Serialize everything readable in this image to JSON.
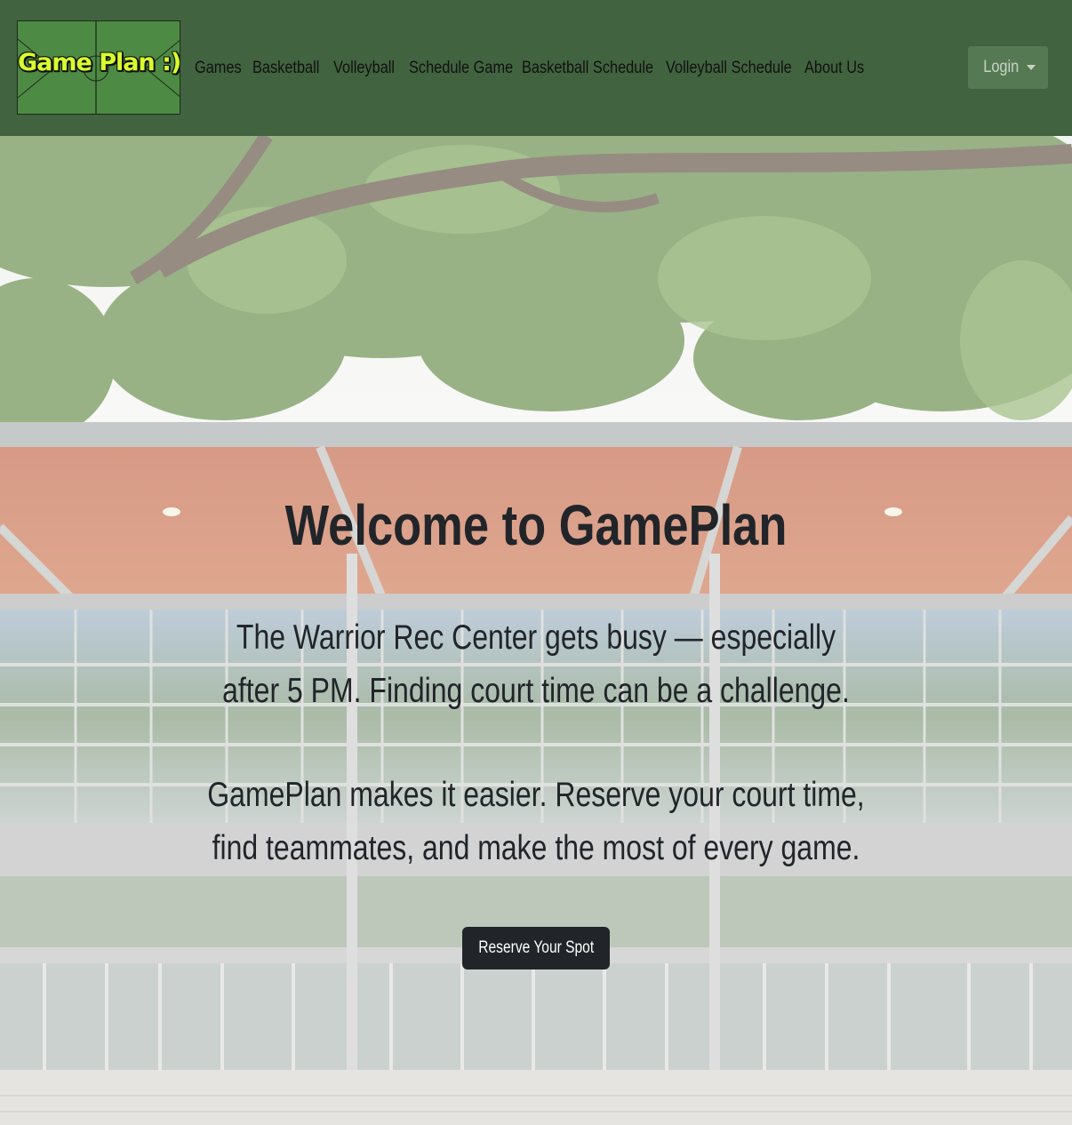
{
  "brand": {
    "logo_text": "Game Plan :)"
  },
  "nav": {
    "items": [
      {
        "label": "Games"
      },
      {
        "label": "Basketball"
      },
      {
        "label": "Volleyball"
      },
      {
        "label": "Schedule Game"
      },
      {
        "label": "Basketball Schedule"
      },
      {
        "label": "Volleyball Schedule"
      },
      {
        "label": "About Us"
      }
    ],
    "login_label": "Login"
  },
  "hero": {
    "title": "Welcome to GamePlan",
    "paragraph_1": "The Warrior Rec Center gets busy — especially after 5 PM. Finding court time can be a challenge.",
    "paragraph_2": "GamePlan makes it easier. Reserve your court time, find teammates, and make the most of every game.",
    "cta_label": "Reserve Your Spot"
  },
  "colors": {
    "navbar_bg": "#41633f",
    "logo_bg": "#4d8a44",
    "logo_text": "#d9ff2e",
    "login_bg": "#557a53",
    "cta_bg": "#212529",
    "text": "#212529"
  }
}
